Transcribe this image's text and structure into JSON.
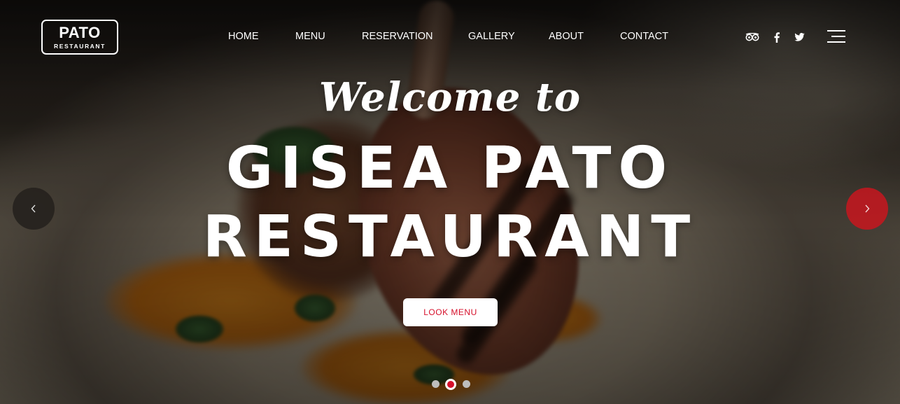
{
  "brand": {
    "name": "PATO",
    "tagline": "RESTAURANT"
  },
  "nav": [
    {
      "label": "HOME"
    },
    {
      "label": "MENU"
    },
    {
      "label": "RESERVATION"
    },
    {
      "label": "GALLERY"
    },
    {
      "label": "ABOUT"
    },
    {
      "label": "CONTACT"
    }
  ],
  "social": [
    {
      "icon": "tripadvisor-icon"
    },
    {
      "icon": "facebook-icon"
    },
    {
      "icon": "twitter-icon"
    }
  ],
  "hero": {
    "script": "Welcome to",
    "title_line1": "GISEA PATO",
    "title_line2": "RESTAURANT",
    "button_label": "LOOK MENU"
  },
  "slider": {
    "slide_count": 3,
    "active_index": 1
  },
  "colors": {
    "accent": "#d6102b",
    "text": "#ffffff",
    "arrow_dark": "#23201c"
  }
}
